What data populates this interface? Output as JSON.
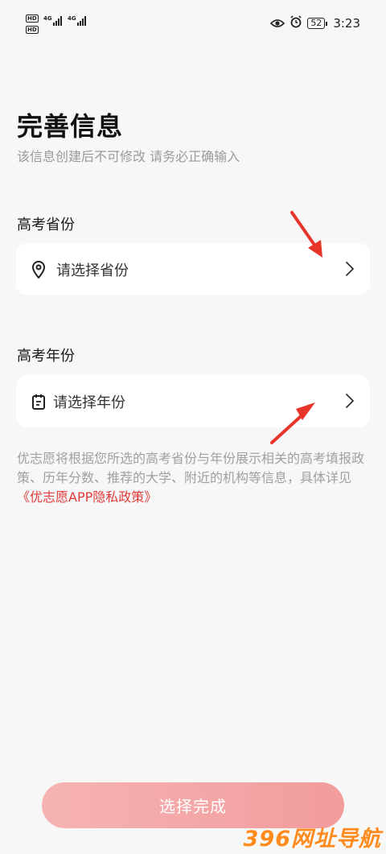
{
  "status_bar": {
    "hd_1": "HD",
    "hd_2": "HD",
    "network_1": "4G",
    "network_2": "4G",
    "battery": "52",
    "time": "3:23",
    "icons": [
      "eye-icon",
      "alarm-icon"
    ]
  },
  "header": {
    "title": "完善信息",
    "subtitle": "该信息创建后不可修改  请务必正确输入"
  },
  "province": {
    "label": "高考省份",
    "placeholder": "请选择省份",
    "icon": "location-pin-icon"
  },
  "year": {
    "label": "高考年份",
    "placeholder": "请选择年份",
    "icon": "calendar-icon"
  },
  "info": {
    "text": "优志愿将根据您所选的高考省份与年份展示相关的高考填报政策、历年分数、推荐的大学、附近的机构等信息，具体详见",
    "link": "《优志愿APP隐私政策》"
  },
  "footer": {
    "done_label": "选择完成"
  },
  "watermark": "396网址导航",
  "colors": {
    "accent_red": "#e23b3b",
    "button_gradient_start": "#f6b3b3",
    "button_gradient_end": "#f29c9c",
    "background": "#f7f7f7"
  }
}
